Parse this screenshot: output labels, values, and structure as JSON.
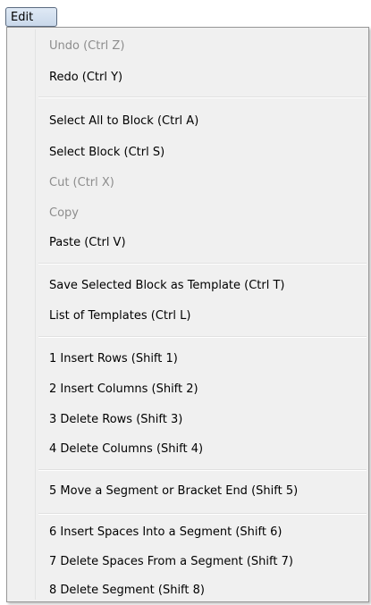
{
  "menubar": {
    "edit_label": "Edit"
  },
  "menu": {
    "items": [
      {
        "label": "Undo (Ctrl Z)",
        "enabled": false
      },
      {
        "label": "Redo (Ctrl Y)",
        "enabled": true
      },
      {
        "label": "Select All to Block (Ctrl A)",
        "enabled": true
      },
      {
        "label": "Select Block (Ctrl S)",
        "enabled": true
      },
      {
        "label": "Cut (Ctrl X)",
        "enabled": false
      },
      {
        "label": "Copy",
        "enabled": false
      },
      {
        "label": "Paste (Ctrl V)",
        "enabled": true
      },
      {
        "label": "Save Selected Block as Template (Ctrl T)",
        "enabled": true
      },
      {
        "label": "List of Templates (Ctrl L)",
        "enabled": true
      },
      {
        "label": "1 Insert Rows (Shift 1)",
        "enabled": true
      },
      {
        "label": "2 Insert Columns (Shift 2)",
        "enabled": true
      },
      {
        "label": "3 Delete Rows  (Shift 3)",
        "enabled": true
      },
      {
        "label": "4 Delete Columns  (Shift 4)",
        "enabled": true
      },
      {
        "label": "5 Move a Segment or Bracket End (Shift 5)",
        "enabled": true
      },
      {
        "label": "6 Insert Spaces Into a Segment (Shift 6)",
        "enabled": true
      },
      {
        "label": "7 Delete Spaces From a Segment  (Shift 7)",
        "enabled": true
      },
      {
        "label": "8 Delete Segment   (Shift 8)",
        "enabled": true
      }
    ]
  }
}
